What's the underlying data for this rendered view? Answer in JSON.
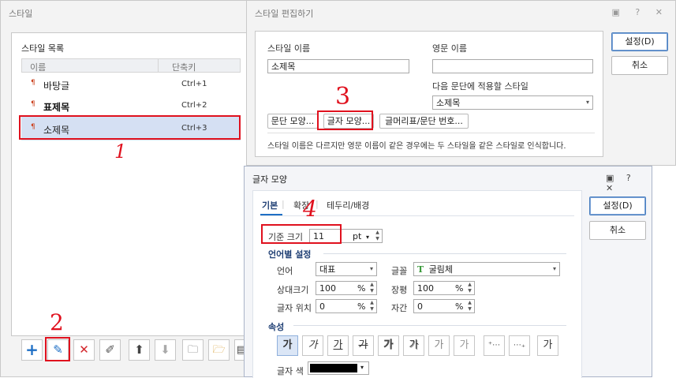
{
  "style_window": {
    "title": "스타일",
    "list_title": "스타일 목록",
    "col_name": "이름",
    "col_shortcut": "단축키",
    "rows": [
      {
        "name": "바탕글",
        "shortcut": "Ctrl+1"
      },
      {
        "name": "표제목",
        "shortcut": "Ctrl+2"
      },
      {
        "name": "소제목",
        "shortcut": "Ctrl+3"
      }
    ],
    "toolbar_icons": [
      "plus-icon",
      "pencil-icon",
      "delete-icon",
      "edit-all-icon",
      "arrow-up-icon",
      "arrow-down-icon",
      "folder-import-icon",
      "folder-open-icon",
      "save-icon"
    ]
  },
  "edit_window": {
    "title": "스타일 편집하기",
    "title_icons": "▣ ? ✕",
    "style_name_label": "스타일 이름",
    "style_name_value": "소제목",
    "english_name_label": "영문 이름",
    "english_name_value": "",
    "next_style_label": "다음 문단에 적용할 스타일",
    "next_style_value": "소제목",
    "para_shape_btn": "문단 모양...",
    "char_shape_btn": "글자 모양...",
    "bullet_btn": "글머리표/문단 번호...",
    "note": "스타일 이름은 다르지만 영문 이름이 같은 경우에는 두 스타일을 같은 스타일로 인식합니다.",
    "ok_btn": "설정(D)",
    "cancel_btn": "취소"
  },
  "char_window": {
    "title": "글자 모양",
    "title_icons": "▣ ? ✕",
    "tabs": [
      "기본",
      "확장",
      "테두리/배경"
    ],
    "base_size_label": "기준 크기",
    "base_size_value": "11",
    "base_size_unit": "pt",
    "lang_section": "언어별 설정",
    "lang_label": "언어",
    "lang_value": "대표",
    "font_label": "글꼴",
    "font_value": "굴림체",
    "rel_size_label": "상대크기",
    "rel_size_value": "100",
    "width_label": "장평",
    "width_value": "100",
    "pos_label": "글자 위치",
    "pos_value": "0",
    "spacing_label": "자간",
    "spacing_value": "0",
    "percent": "%",
    "attr_section": "속성",
    "attr_glyph": "가",
    "color_label": "글자 색",
    "ok_btn": "설정(D)",
    "cancel_btn": "취소"
  },
  "annotations": {
    "a1": "1",
    "a2": "2",
    "a3": "3",
    "a4": "4"
  },
  "colors": {
    "highlight": "#e0111e",
    "selection": "#d5e0f3",
    "accent": "#1f6fc5"
  }
}
